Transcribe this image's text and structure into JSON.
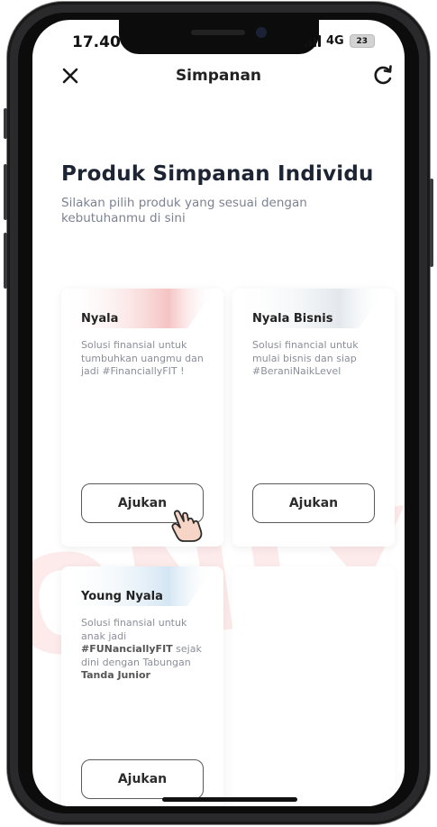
{
  "status_bar": {
    "time": "17.40",
    "network": "4G",
    "battery": "23",
    "icons": [
      "location-arrow-icon",
      "signal-bars-icon"
    ]
  },
  "header": {
    "title": "Simpanan",
    "close_icon": "close-icon",
    "refresh_icon": "refresh-icon"
  },
  "page": {
    "title": "Produk Simpanan Individu",
    "subtitle": "Silakan pilih produk yang sesuai dengan kebutuhanmu di sini"
  },
  "products": [
    {
      "name": "Nyala",
      "description": "Solusi finansial untuk tumbuhkan uangmu dan jadi #FinanciallyFIT !",
      "button_label": "Ajukan",
      "accent": "#f4b8b8"
    },
    {
      "name": "Nyala Bisnis",
      "description": "Solusi financial untuk mulai bisnis dan siap #BeraniNaikLevel",
      "button_label": "Ajukan",
      "accent": "#dfe5ea"
    },
    {
      "name": "Young Nyala",
      "description_parts": [
        "Solusi finansial untuk anak jadi ",
        "#FUNanciallyFIT",
        " sejak dini dengan Tabungan ",
        "Tanda Junior"
      ],
      "button_label": "Ajukan",
      "accent": "#cfe3f2"
    }
  ],
  "watermark": "ONLY",
  "colors": {
    "title": "#1d2433",
    "subtitle": "#7b8290",
    "frame": "#2a2a2c"
  }
}
